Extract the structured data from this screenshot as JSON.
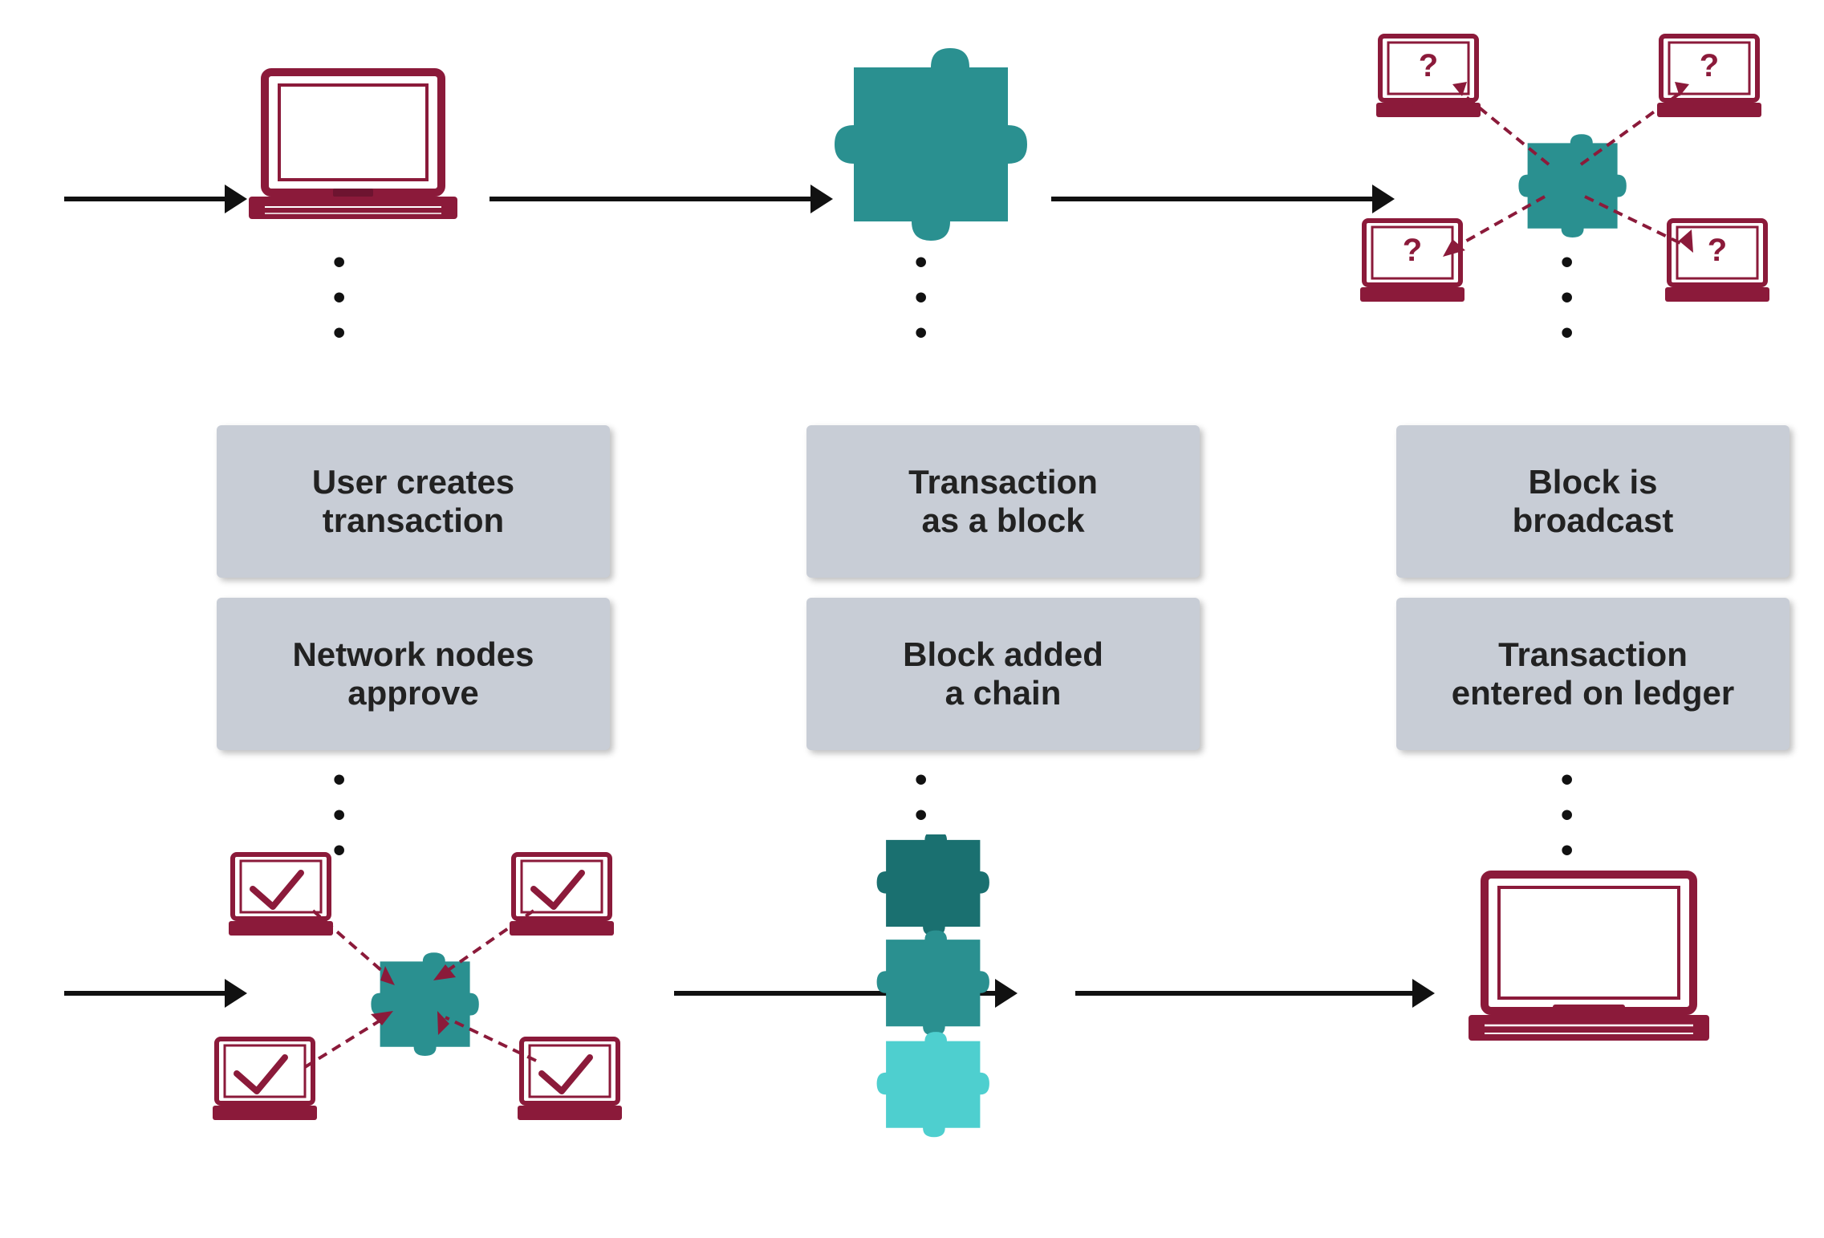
{
  "labels": {
    "user_creates": "User creates\ntransaction",
    "transaction_block": "Transaction\nas a block",
    "block_broadcast": "Block is\nbroadcast",
    "network_nodes": "Network nodes\napprove",
    "block_added": "Block added\na chain",
    "transaction_ledger": "Transaction\nentered on ledger"
  },
  "colors": {
    "crimson": "#8B1A3A",
    "teal": "#2A9090",
    "teal_light": "#3DBFBF",
    "arrow": "#111111",
    "label_bg": "#C8CDD6",
    "dashed_arrow": "#8B1A3A"
  }
}
